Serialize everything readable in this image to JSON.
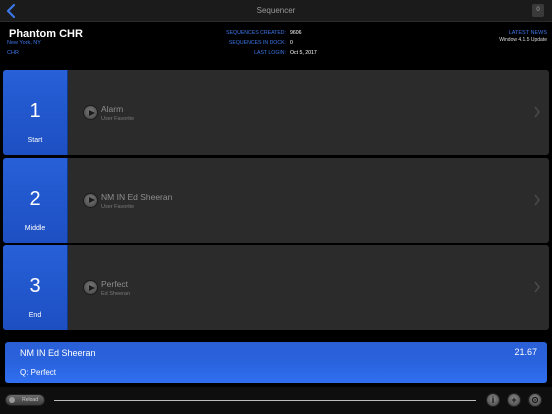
{
  "nav": {
    "title": "Sequencer",
    "right_badge": "0"
  },
  "header": {
    "station_name": "Phantom CHR",
    "location": "New York, NY",
    "format": "CHR",
    "stats": [
      {
        "label": "SEQUENCES CREATED:",
        "value": "9606"
      },
      {
        "label": "SEQUENCES IN DOCK:",
        "value": "0"
      },
      {
        "label": "LAST LOGIN:",
        "value": "Oct 5, 2017"
      }
    ],
    "news_label": "LATEST NEWS",
    "news_ticker": "Window 4.1.5 Update"
  },
  "slots": [
    {
      "number": "1",
      "position": "Start",
      "title": "Alarm",
      "subtitle": "User Favorite"
    },
    {
      "number": "2",
      "position": "Middle",
      "title": "NM IN Ed Sheeran",
      "subtitle": "User Favorite"
    },
    {
      "number": "3",
      "position": "End",
      "title": "Perfect",
      "subtitle": "Ed Sheeran"
    }
  ],
  "now_playing": {
    "title": "NM IN Ed Sheeran",
    "time": "21.67",
    "next": "Q: Perfect"
  },
  "toolbar": {
    "pill_label": "Reload",
    "info_icon": "info-icon",
    "add_icon": "plus-icon",
    "settings_icon": "gear-icon"
  },
  "colors": {
    "accent": "#3b76e8",
    "slot_blue": "#2760d8",
    "card_bg": "#2b2b2b"
  }
}
